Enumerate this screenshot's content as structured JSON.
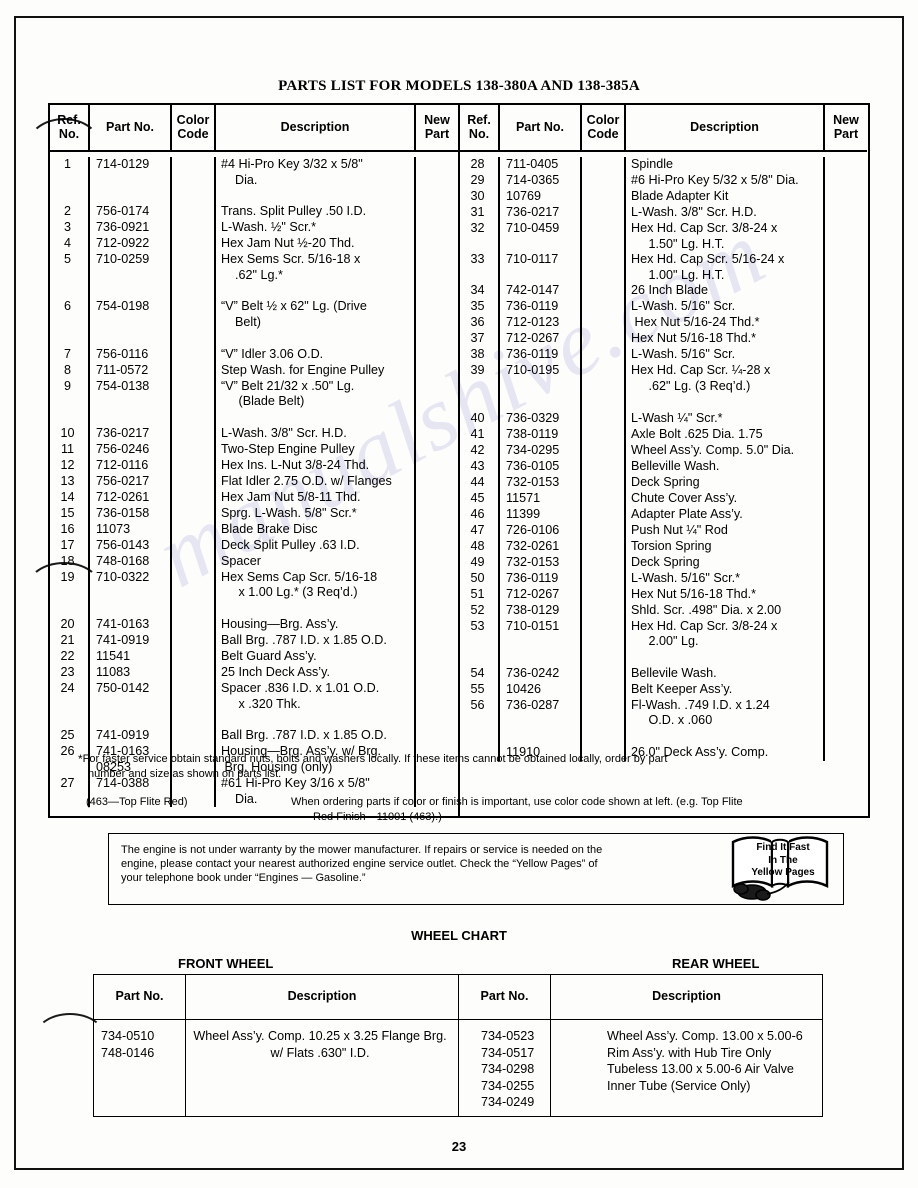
{
  "document": {
    "title": "PARTS LIST FOR MODELS 138-380A AND 138-385A",
    "page_number": "23",
    "watermark": "manualshive.com"
  },
  "parts_table": {
    "headers": {
      "ref_no": "Ref.\nNo.",
      "part_no": "Part\nNo.",
      "color_code": "Color\nCode",
      "description": "Description",
      "new_part": "New\nPart"
    },
    "left_rows": [
      {
        "ref": "1",
        "part": "714-0129",
        "color": "",
        "desc": "#4 Hi-Pro Key 3/32 x 5/8\"\n    Dia.",
        "new": ""
      },
      {
        "ref": "",
        "part": "",
        "color": "",
        "desc": "",
        "new": "",
        "spacer": true
      },
      {
        "ref": "2",
        "part": "756-0174",
        "color": "",
        "desc": "Trans. Split Pulley .50 I.D.",
        "new": ""
      },
      {
        "ref": "3",
        "part": "736-0921",
        "color": "",
        "desc": "L-Wash. ½\" Scr.*",
        "new": ""
      },
      {
        "ref": "4",
        "part": "712-0922",
        "color": "",
        "desc": "Hex Jam Nut ½-20 Thd.",
        "new": ""
      },
      {
        "ref": "5",
        "part": "710-0259",
        "color": "",
        "desc": "Hex Sems Scr. 5/16-18 x\n    .62\" Lg.*",
        "new": ""
      },
      {
        "ref": "",
        "part": "",
        "color": "",
        "desc": "",
        "new": "",
        "spacer": true
      },
      {
        "ref": "6",
        "part": "754-0198",
        "color": "",
        "desc": "“V” Belt ½ x 62\" Lg. (Drive\n    Belt)",
        "new": ""
      },
      {
        "ref": "",
        "part": "",
        "color": "",
        "desc": "",
        "new": "",
        "spacer": true
      },
      {
        "ref": "7",
        "part": "756-0116",
        "color": "",
        "desc": "“V” Idler 3.06 O.D.",
        "new": ""
      },
      {
        "ref": "8",
        "part": "711-0572",
        "color": "",
        "desc": "Step Wash. for Engine Pulley",
        "new": ""
      },
      {
        "ref": "9",
        "part": "754-0138",
        "color": "",
        "desc": "“V” Belt 21/32 x .50\" Lg.\n     (Blade Belt)",
        "new": ""
      },
      {
        "ref": "",
        "part": "",
        "color": "",
        "desc": "",
        "new": "",
        "spacer": true
      },
      {
        "ref": "10",
        "part": "736-0217",
        "color": "",
        "desc": "L-Wash. 3/8\" Scr. H.D.",
        "new": ""
      },
      {
        "ref": "11",
        "part": "756-0246",
        "color": "",
        "desc": "Two-Step Engine Pulley",
        "new": ""
      },
      {
        "ref": "12",
        "part": "712-0116",
        "color": "",
        "desc": "Hex Ins. L-Nut 3/8-24 Thd.",
        "new": ""
      },
      {
        "ref": "13",
        "part": "756-0217",
        "color": "",
        "desc": "Flat Idler 2.75 O.D. w/ Flanges",
        "new": ""
      },
      {
        "ref": "14",
        "part": "712-0261",
        "color": "",
        "desc": "Hex Jam Nut 5/8-11 Thd.",
        "new": ""
      },
      {
        "ref": "15",
        "part": "736-0158",
        "color": "",
        "desc": "Sprg. L-Wash. 5/8\" Scr.*",
        "new": ""
      },
      {
        "ref": "16",
        "part": "11073",
        "color": "",
        "desc": "Blade Brake Disc",
        "new": ""
      },
      {
        "ref": "17",
        "part": "756-0143",
        "color": "",
        "desc": "Deck Split Pulley .63 I.D.",
        "new": ""
      },
      {
        "ref": "18",
        "part": "748-0168",
        "color": "",
        "desc": "Spacer",
        "new": ""
      },
      {
        "ref": "19",
        "part": "710-0322",
        "color": "",
        "desc": "Hex Sems Cap Scr. 5/16-18\n     x 1.00 Lg.* (3 Req’d.)",
        "new": ""
      },
      {
        "ref": "",
        "part": "",
        "color": "",
        "desc": "",
        "new": "",
        "spacer": true
      },
      {
        "ref": "20",
        "part": "741-0163",
        "color": "",
        "desc": "Housing—Brg. Ass’y.",
        "new": ""
      },
      {
        "ref": "21",
        "part": "741-0919",
        "color": "",
        "desc": "Ball Brg. .787 I.D. x 1.85 O.D.",
        "new": ""
      },
      {
        "ref": "22",
        "part": "11541",
        "color": "",
        "desc": "Belt Guard Ass’y.",
        "new": ""
      },
      {
        "ref": "23",
        "part": "11083",
        "color": "",
        "desc": "25 Inch Deck Ass’y.",
        "new": ""
      },
      {
        "ref": "24",
        "part": "750-0142",
        "color": "",
        "desc": "Spacer .836 I.D. x 1.01 O.D.\n     x .320 Thk.",
        "new": ""
      },
      {
        "ref": "",
        "part": "",
        "color": "",
        "desc": "",
        "new": "",
        "spacer": true
      },
      {
        "ref": "25",
        "part": "741-0919",
        "color": "",
        "desc": "Ball Brg. .787 I.D. x 1.85 O.D.",
        "new": ""
      },
      {
        "ref": "26",
        "part": "741-0163",
        "color": "",
        "desc": "Housing—Brg. Ass’y. w/ Brg.",
        "new": ""
      },
      {
        "ref": "",
        "part": "08253",
        "color": "",
        "desc": " Brg. Housing (only)",
        "new": ""
      },
      {
        "ref": "27",
        "part": "714-0388",
        "color": "",
        "desc": "#61 Hi-Pro Key 3/16 x 5/8\"\n    Dia.",
        "new": ""
      }
    ],
    "right_rows": [
      {
        "ref": "28",
        "part": "711-0405",
        "color": "",
        "desc": "Spindle",
        "new": ""
      },
      {
        "ref": "29",
        "part": "714-0365",
        "color": "",
        "desc": "#6 Hi-Pro Key 5/32 x 5/8\" Dia.",
        "new": ""
      },
      {
        "ref": "30",
        "part": "10769",
        "color": "",
        "desc": "Blade Adapter Kit",
        "new": ""
      },
      {
        "ref": "31",
        "part": "736-0217",
        "color": "",
        "desc": "L-Wash. 3/8\" Scr. H.D.",
        "new": ""
      },
      {
        "ref": "32",
        "part": "710-0459",
        "color": "",
        "desc": "Hex Hd. Cap Scr. 3/8-24 x\n     1.50\" Lg. H.T.",
        "new": ""
      },
      {
        "ref": "33",
        "part": "710-0117",
        "color": "",
        "desc": "Hex Hd. Cap Scr. 5/16-24 x\n     1.00\" Lg. H.T.",
        "new": ""
      },
      {
        "ref": "34",
        "part": "742-0147",
        "color": "",
        "desc": "26 Inch Blade",
        "new": ""
      },
      {
        "ref": "35",
        "part": "736-0119",
        "color": "",
        "desc": "L-Wash. 5/16\" Scr.",
        "new": ""
      },
      {
        "ref": "36",
        "part": "712-0123",
        "color": "",
        "desc": " Hex Nut 5/16-24 Thd.*",
        "new": ""
      },
      {
        "ref": "37",
        "part": "712-0267",
        "color": "",
        "desc": "Hex Nut 5/16-18 Thd.*",
        "new": ""
      },
      {
        "ref": "38",
        "part": "736-0119",
        "color": "",
        "desc": "L-Wash. 5/16\" Scr.",
        "new": ""
      },
      {
        "ref": "39",
        "part": "710-0195",
        "color": "",
        "desc": "Hex Hd. Cap Scr. ¼-28 x\n     .62\" Lg. (3 Req’d.)",
        "new": ""
      },
      {
        "ref": "",
        "part": "",
        "color": "",
        "desc": "",
        "new": "",
        "spacer": true
      },
      {
        "ref": "40",
        "part": "736-0329",
        "color": "",
        "desc": "L-Wash ¼\" Scr.*",
        "new": ""
      },
      {
        "ref": "41",
        "part": "738-0119",
        "color": "",
        "desc": "Axle Bolt .625 Dia. 1.75",
        "new": ""
      },
      {
        "ref": "42",
        "part": "734-0295",
        "color": "",
        "desc": "Wheel Ass’y. Comp. 5.0\" Dia.",
        "new": ""
      },
      {
        "ref": "43",
        "part": "736-0105",
        "color": "",
        "desc": "Belleville Wash.",
        "new": ""
      },
      {
        "ref": "44",
        "part": "732-0153",
        "color": "",
        "desc": "Deck Spring",
        "new": ""
      },
      {
        "ref": "45",
        "part": "11571",
        "color": "",
        "desc": "Chute Cover Ass’y.",
        "new": ""
      },
      {
        "ref": "46",
        "part": "11399",
        "color": "",
        "desc": "Adapter Plate Ass’y.",
        "new": ""
      },
      {
        "ref": "47",
        "part": "726-0106",
        "color": "",
        "desc": "Push Nut ¼\" Rod",
        "new": ""
      },
      {
        "ref": "48",
        "part": "732-0261",
        "color": "",
        "desc": "Torsion Spring",
        "new": ""
      },
      {
        "ref": "49",
        "part": "732-0153",
        "color": "",
        "desc": "Deck Spring",
        "new": ""
      },
      {
        "ref": "50",
        "part": "736-0119",
        "color": "",
        "desc": "L-Wash. 5/16\" Scr.*",
        "new": ""
      },
      {
        "ref": "51",
        "part": "712-0267",
        "color": "",
        "desc": "Hex Nut 5/16-18 Thd.*",
        "new": ""
      },
      {
        "ref": "52",
        "part": "738-0129",
        "color": "",
        "desc": "Shld. Scr. .498\" Dia. x 2.00",
        "new": ""
      },
      {
        "ref": "53",
        "part": "710-0151",
        "color": "",
        "desc": "Hex Hd. Cap Scr. 3/8-24 x\n     2.00\" Lg.",
        "new": ""
      },
      {
        "ref": "",
        "part": "",
        "color": "",
        "desc": "",
        "new": "",
        "spacer": true
      },
      {
        "ref": "54",
        "part": "736-0242",
        "color": "",
        "desc": "Bellevile Wash.",
        "new": ""
      },
      {
        "ref": "55",
        "part": "10426",
        "color": "",
        "desc": "Belt Keeper Ass’y.",
        "new": ""
      },
      {
        "ref": "56",
        "part": "736-0287",
        "color": "",
        "desc": "Fl-Wash. .749 I.D. x 1.24\n     O.D. x .060",
        "new": ""
      },
      {
        "ref": "",
        "part": "",
        "color": "",
        "desc": "",
        "new": "",
        "spacer": true
      },
      {
        "ref": "",
        "part": "11910",
        "color": "",
        "desc": "26.0\" Deck Ass’y. Comp.",
        "new": ""
      }
    ]
  },
  "footnotes": {
    "star_note_line1": "For faster service obtain standard nuts, bolts and washers locally. If these items cannot be obtained locally, order by part",
    "star_note_line2": "number and size as shown on parts list.",
    "color_code_example": "(463—Top Flite Red)",
    "color_note_line1": "When ordering parts if color or finish is important, use color code shown at left. (e.g. Top Flite",
    "color_note_line2": "Red Finish—11001 (463).)"
  },
  "engine_box": {
    "text_line1": "The engine is not under warranty by the mower manufacturer. If repairs or service is needed on the",
    "text_line2": "engine, please contact your nearest authorized engine service outlet. Check the “Yellow Pages” of",
    "text_line3": "your telephone book under “Engines — Gasoline.”",
    "badge_line1": "Find It Fast",
    "badge_line2": "In The",
    "badge_line3": "Yellow Pages"
  },
  "wheel_chart": {
    "title": "WHEEL CHART",
    "front_label": "FRONT WHEEL",
    "rear_label": "REAR WHEEL",
    "headers": {
      "part_no": "Part\nNo.",
      "description": "Description"
    },
    "front_part_numbers": "734-0510\n748-0146",
    "front_descriptions": "Wheel Ass’y. Comp. 10.25 x 3.25\nFlange Brg. w/ Flats .630\" I.D.",
    "rear_part_numbers": "734-0523\n734-0517\n734-0298\n734-0255\n734-0249",
    "rear_descriptions": "Wheel Ass’y. Comp. 13.00 x 5.00-6\nRim Ass’y. with Hub\nTire Only Tubeless 13.00 x 5.00-6\nAir Valve\nInner Tube (Service Only)"
  }
}
